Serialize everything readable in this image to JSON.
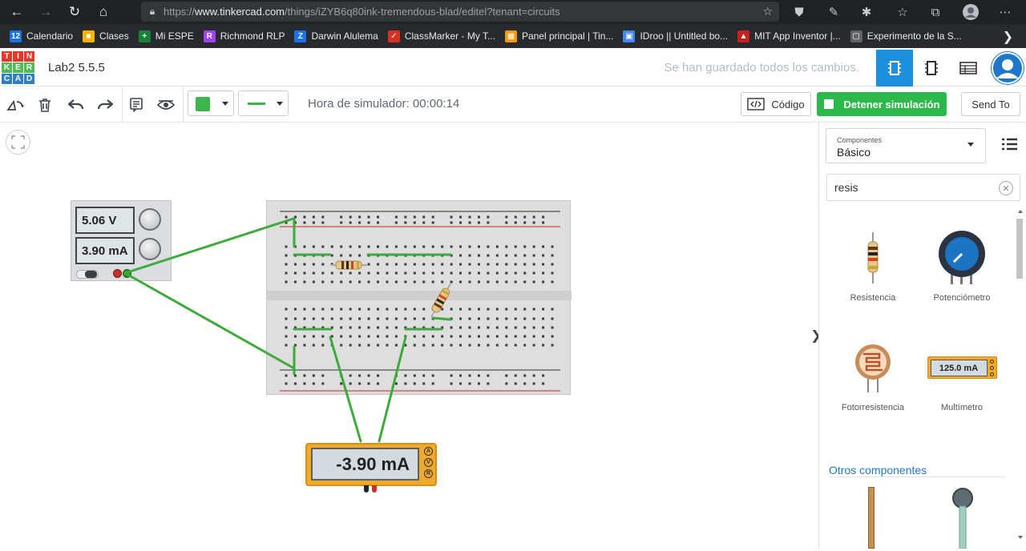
{
  "browser": {
    "url_prefix": "https://",
    "url_host": "www.tinkercad.com",
    "url_path": "/things/iZYB6q80ink-tremendous-blad/editel?tenant=circuits"
  },
  "bookmarks": [
    {
      "label": "Calendario",
      "color": "#1a73e8",
      "glyph": "12"
    },
    {
      "label": "Clases",
      "color": "#f4b400",
      "glyph": "■"
    },
    {
      "label": "Mi ESPE",
      "color": "#188038",
      "glyph": "+"
    },
    {
      "label": "Richmond RLP",
      "color": "#a142f4",
      "glyph": "R"
    },
    {
      "label": "Darwin Alulema",
      "color": "#1a73e8",
      "glyph": "Z"
    },
    {
      "label": "ClassMarker - My T...",
      "color": "#d93025",
      "glyph": "✓"
    },
    {
      "label": "Panel principal | Tin...",
      "color": "#f29900",
      "glyph": "▦"
    },
    {
      "label": "IDroo || Untitled bo...",
      "color": "#4285f4",
      "glyph": "▣"
    },
    {
      "label": "MIT App Inventor |...",
      "color": "#c5221f",
      "glyph": "▲"
    },
    {
      "label": "Experimento de la S...",
      "color": "#5f6368",
      "glyph": "▢"
    }
  ],
  "app": {
    "logo_letters": [
      "T",
      "I",
      "N",
      "K",
      "E",
      "R",
      "C",
      "A",
      "D"
    ],
    "project_title": "Lab2 5.5.5",
    "save_status": "Se han guardado todos los cambios."
  },
  "toolbar": {
    "sim_time": "Hora de simulador: 00:00:14",
    "code_label": "Código",
    "stop_label": "Detener simulación",
    "send_label": "Send To"
  },
  "circuit": {
    "power_voltage": "5.06 V",
    "power_current": "3.90 mA",
    "multimeter_reading": "-3.90 mA",
    "multimeter_modes": [
      "A",
      "V",
      "R"
    ]
  },
  "sidebar": {
    "components_label": "Componentes",
    "components_value": "Básico",
    "search_value": "resis",
    "items": [
      {
        "label": "Resistencia"
      },
      {
        "label": "Potenciómetro"
      },
      {
        "label": "Fotorresistencia"
      },
      {
        "label": "Multímetro",
        "display": "125.0 mA"
      }
    ],
    "others_label": "Otros componentes"
  },
  "colors": {
    "accent": "#1e79c8",
    "stop_green": "#2db84c",
    "wire_green": "#3dab3b",
    "multimeter": "#f0a92a"
  }
}
